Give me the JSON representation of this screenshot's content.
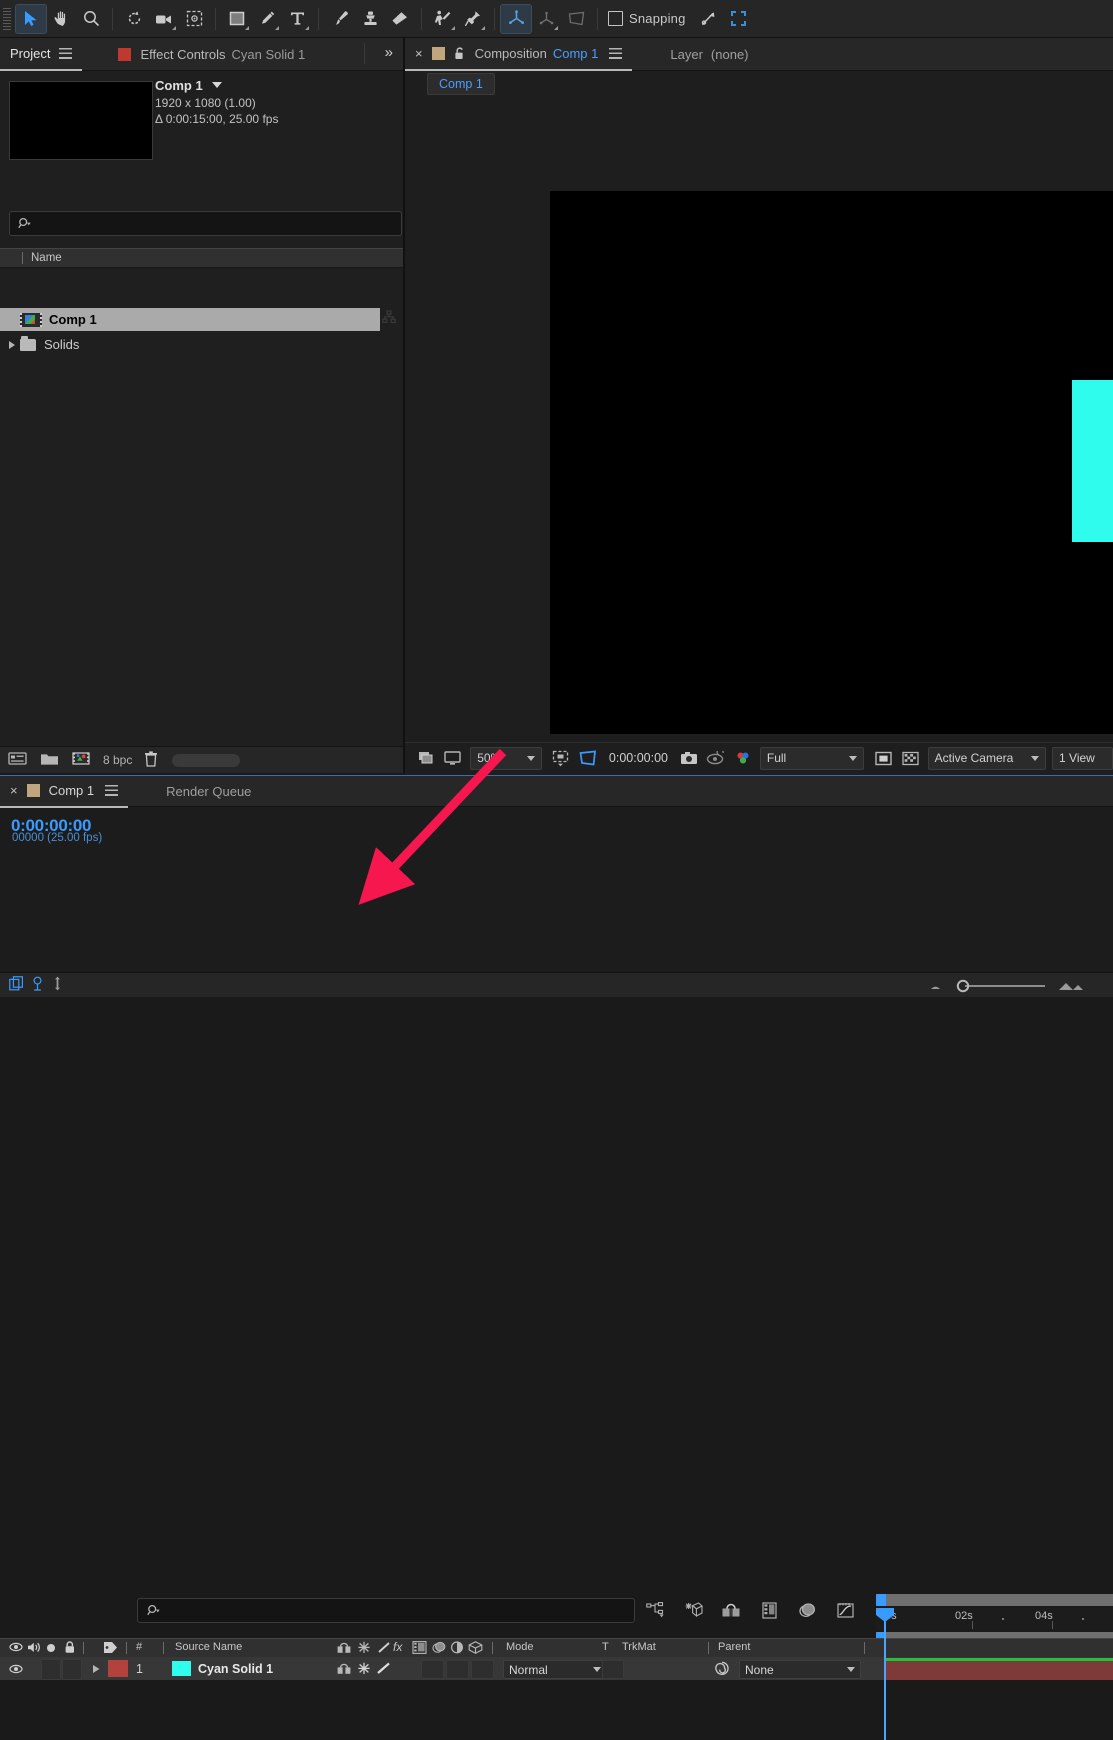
{
  "toolbar": {
    "tools": [
      {
        "name": "selection-tool",
        "label": "Selection",
        "selected": true
      },
      {
        "name": "hand-tool",
        "label": "Hand",
        "selected": false
      },
      {
        "name": "zoom-tool",
        "label": "Zoom",
        "selected": false
      },
      {
        "name": "rotation-tool",
        "label": "Rotation",
        "selected": false
      },
      {
        "name": "camera-tool",
        "label": "Unified Camera",
        "selected": false
      },
      {
        "name": "pan-behind-tool",
        "label": "Pan Behind",
        "selected": false
      },
      {
        "name": "shape-tool",
        "label": "Rectangle",
        "selected": false
      },
      {
        "name": "pen-tool",
        "label": "Pen",
        "selected": false
      },
      {
        "name": "type-tool",
        "label": "Type",
        "selected": false
      },
      {
        "name": "brush-tool",
        "label": "Brush",
        "selected": false
      },
      {
        "name": "clone-stamp-tool",
        "label": "Clone Stamp",
        "selected": false
      },
      {
        "name": "eraser-tool",
        "label": "Eraser",
        "selected": false
      },
      {
        "name": "roto-brush-tool",
        "label": "Roto Brush",
        "selected": false
      },
      {
        "name": "puppet-pin-tool",
        "label": "Puppet Pin",
        "selected": false
      }
    ],
    "axis_modes": [
      {
        "name": "local-axis-mode",
        "selected": true
      },
      {
        "name": "world-axis-mode",
        "selected": false
      },
      {
        "name": "view-axis-mode",
        "selected": false
      }
    ],
    "snapping_label": "Snapping",
    "snapping_checked": false
  },
  "project": {
    "tabs": [
      {
        "label": "Project",
        "active": true
      },
      {
        "label": "Effect Controls",
        "active": false,
        "suffix": "Cyan Solid 1"
      }
    ],
    "overflow_label": "»",
    "item_info": {
      "name": "Comp 1",
      "resolution": "1920 x 1080 (1.00)",
      "duration": "Δ 0:00:15:00, 25.00 fps"
    },
    "search_placeholder": "",
    "column_header": "Name",
    "items": [
      {
        "label": "Comp 1",
        "type": "composition",
        "selected": true
      },
      {
        "label": "Solids",
        "type": "folder",
        "selected": false
      }
    ],
    "footer": {
      "bit_depth": "8 bpc"
    }
  },
  "composition": {
    "tab_close": "×",
    "panel_label": "Composition",
    "comp_name": "Comp 1",
    "layer_label": "Layer",
    "layer_value": "(none)",
    "breadcrumb": "Comp 1",
    "canvas_bg": "#000000",
    "solid_color": "#2ffcec",
    "footer": {
      "magnification": "50%",
      "current_time": "0:00:00:00",
      "resolution": "Full",
      "view_camera": "Active Camera",
      "views": "1 View"
    }
  },
  "timeline": {
    "tabs": [
      {
        "label": "Comp 1",
        "active": true
      },
      {
        "label": "Render Queue",
        "active": false
      }
    ],
    "current_time": "0:00:00:00",
    "frame_info": "00000 (25.00 fps)",
    "search_placeholder": "",
    "columns": {
      "number": "#",
      "source_name": "Source Name",
      "mode": "Mode",
      "track_matte_t": "T",
      "track_matte": "TrkMat",
      "parent": "Parent"
    },
    "ruler_labels": [
      "0s",
      "02s",
      "04s"
    ],
    "layers": [
      {
        "index": "1",
        "source_name": "Cyan Solid 1",
        "label_color": "#b3413c",
        "swatch_color": "#2ffcec",
        "mode": "Normal",
        "parent": "None",
        "visible": true
      }
    ]
  },
  "annotation": {
    "arrow_color": "#f5174e",
    "from": "50% magnification control",
    "to": "layer motion-blur switch"
  }
}
